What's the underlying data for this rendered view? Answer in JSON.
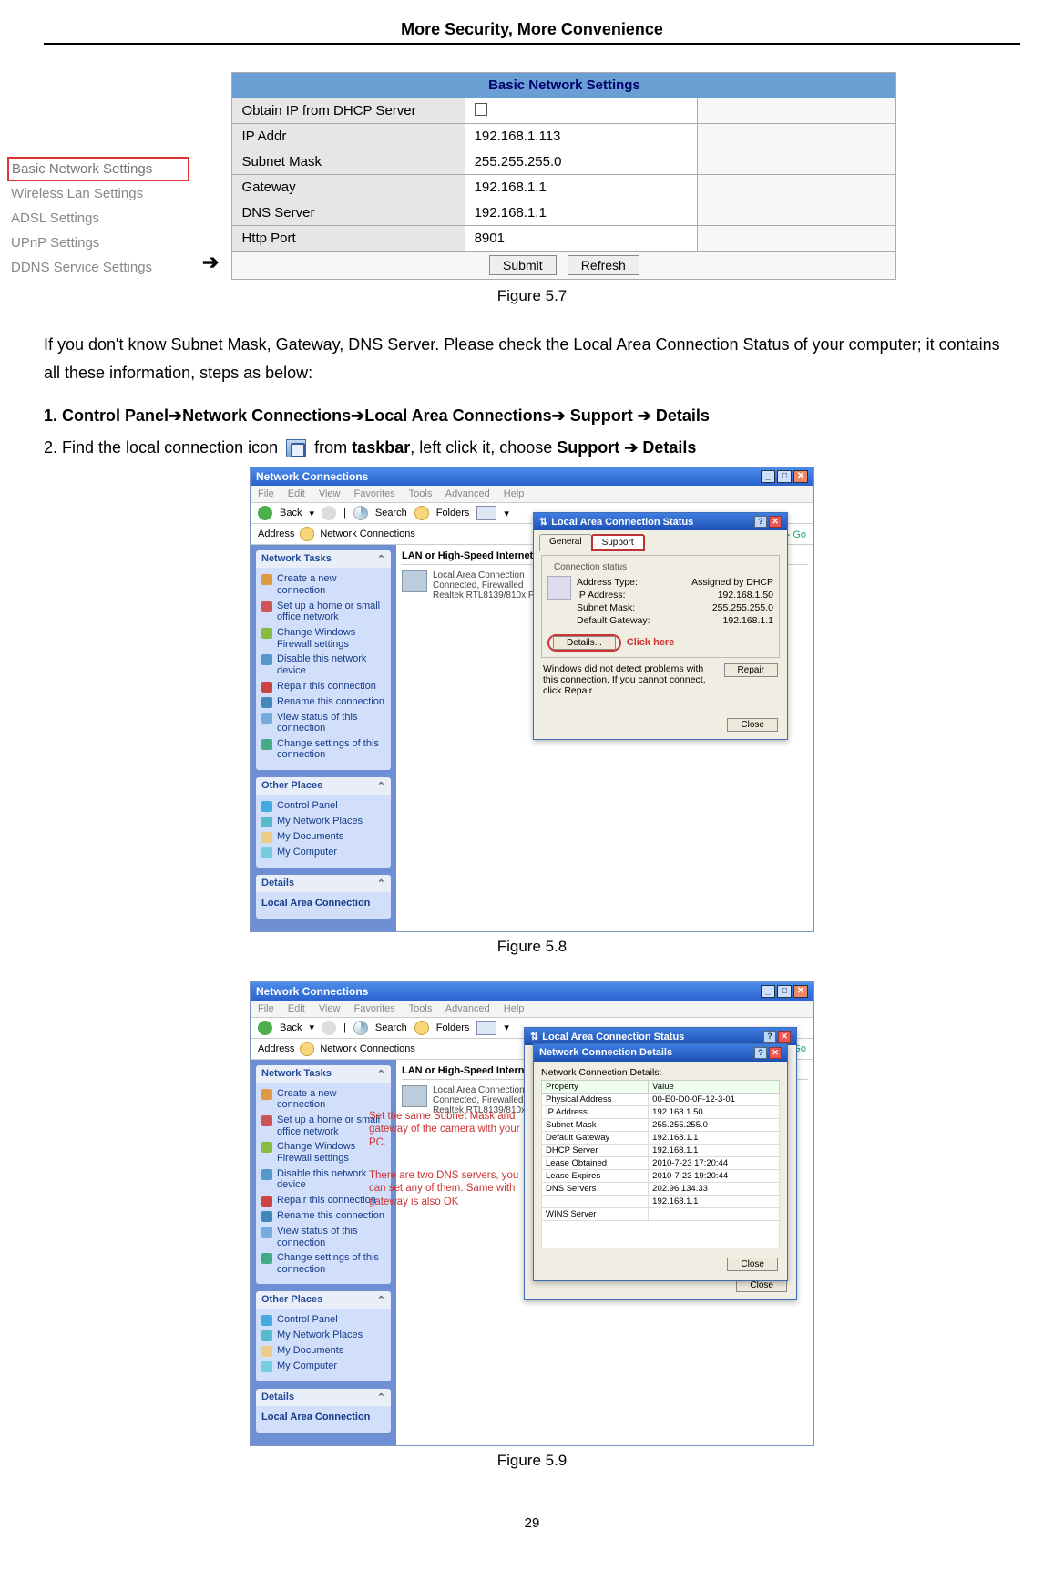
{
  "doc": {
    "title": "More Security, More Convenience",
    "page_num": "29"
  },
  "fig57": {
    "nav_items": [
      "Basic Network Settings",
      "Wireless Lan Settings",
      "ADSL Settings",
      "UPnP Settings",
      "DDNS Service Settings"
    ],
    "table_title": "Basic Network Settings",
    "rows": [
      {
        "label": "Obtain IP from DHCP Server",
        "value": "[checkbox]"
      },
      {
        "label": "IP Addr",
        "value": "192.168.1.113"
      },
      {
        "label": "Subnet Mask",
        "value": "255.255.255.0"
      },
      {
        "label": "Gateway",
        "value": "192.168.1.1"
      },
      {
        "label": "DNS Server",
        "value": "192.168.1.1"
      },
      {
        "label": "Http Port",
        "value": "8901"
      }
    ],
    "submit": "Submit",
    "refresh": "Refresh",
    "caption": "Figure 5.7"
  },
  "para1": "If you don't know Subnet Mask, Gateway, DNS Server. Please check the Local Area Connection Status of your computer; it contains all these information, steps as below:",
  "step1": {
    "prefix": "1. Control Panel",
    "p2": "Network Connections",
    "p3": "Local Area Connections",
    "p4": " Support ",
    "p5": " Details"
  },
  "step2": {
    "prefix": "2. Find the local connection icon ",
    "mid": " from ",
    "taskbar": "taskbar",
    "mid2": ", left click it, choose ",
    "support": "Support ",
    "details": " Details"
  },
  "winCommon": {
    "title": "Network Connections",
    "menu": [
      "File",
      "Edit",
      "View",
      "Favorites",
      "Tools",
      "Advanced",
      "Help"
    ],
    "back": "Back",
    "search": "Search",
    "folders": "Folders",
    "addressLbl": "Address",
    "addressVal": "Network Connections",
    "go": "Go",
    "networkTasks": "Network Tasks",
    "tasks": [
      "Create a new connection",
      "Set up a home or small office network",
      "Change Windows Firewall settings",
      "Disable this network device",
      "Repair this connection",
      "Rename this connection",
      "View status of this connection",
      "Change settings of this connection"
    ],
    "otherPlaces": "Other Places",
    "places": [
      "Control Panel",
      "My Network Places",
      "My Documents",
      "My Computer"
    ],
    "detailsHdr": "Details",
    "detailsLine": "Local Area Connection",
    "contentHdr": "LAN or High-Speed Internet",
    "lanName": "Local Area Connection",
    "lanStatus": "Connected, Firewalled",
    "lanAdapter": "Realtek RTL8139/810x Fa..."
  },
  "fig58": {
    "dlgTitle": "Local Area Connection Status",
    "tabGeneral": "General",
    "tabSupport": "Support",
    "groupTitle": "Connection status",
    "kv": [
      {
        "k": "Address Type:",
        "v": "Assigned by DHCP"
      },
      {
        "k": "IP Address:",
        "v": "192.168.1.50"
      },
      {
        "k": "Subnet Mask:",
        "v": "255.255.255.0"
      },
      {
        "k": "Default Gateway:",
        "v": "192.168.1.1"
      }
    ],
    "detailsBtn": "Details...",
    "clickHere": "Click here",
    "troubleTxt": "Windows did not detect problems with this connection. If you cannot connect, click Repair.",
    "repair": "Repair",
    "close": "Close",
    "caption": "Figure 5.8"
  },
  "fig59": {
    "dlgTitle": "Local Area Connection Status",
    "innerDlgTitle": "Network Connection Details",
    "innerLbl": "Network Connection Details:",
    "th1": "Property",
    "th2": "Value",
    "rows": [
      {
        "p": "Physical Address",
        "v": "00-E0-D0-0F-12-3-01"
      },
      {
        "p": "IP Address",
        "v": "192.168.1.50"
      },
      {
        "p": "Subnet Mask",
        "v": "255.255.255.0"
      },
      {
        "p": "Default Gateway",
        "v": "192.168.1.1"
      },
      {
        "p": "DHCP Server",
        "v": "192.168.1.1"
      },
      {
        "p": "Lease Obtained",
        "v": "2010-7-23 17:20:44"
      },
      {
        "p": "Lease Expires",
        "v": "2010-7-23 19:20:44"
      },
      {
        "p": "DNS Servers",
        "v": "202.96.134.33"
      },
      {
        "p": "",
        "v": "192.168.1.1"
      },
      {
        "p": "WINS Server",
        "v": ""
      }
    ],
    "close": "Close",
    "outerClose": "Close",
    "annot1": "Set the same Subnet Mask and gateway of the camera with your PC.",
    "annot2": "There are two DNS servers, you can set any of them. Same with gateway is also OK",
    "caption": "Figure 5.9"
  }
}
